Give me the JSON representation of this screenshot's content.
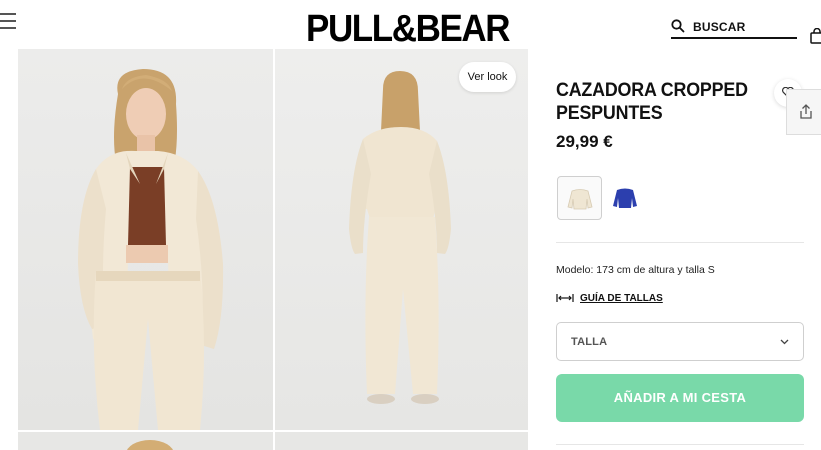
{
  "header": {
    "logo": "PULL&BEAR",
    "search_label": "BUSCAR",
    "menu_icon": "hamburger-menu-icon",
    "search_icon": "search-icon",
    "bag_icon": "shopping-bag-icon"
  },
  "gallery": {
    "ver_look_label": "Ver look"
  },
  "product": {
    "title": "CAZADORA CROPPED PESPUNTES",
    "price": "29,99 €",
    "colors": [
      {
        "name": "ecru",
        "hex": "#efe6d3",
        "selected": true
      },
      {
        "name": "azul",
        "hex": "#2c3fae",
        "selected": false
      }
    ],
    "model_info": "Modelo: 173 cm de altura y talla S",
    "size_guide_label": "GUÍA DE TALLAS",
    "size_placeholder": "TALLA",
    "add_to_cart_label": "AÑADIR A MI CESTA"
  },
  "colors": {
    "accent_button": "#79d9a9",
    "text": "#111111",
    "divider": "#e6e6e6"
  }
}
